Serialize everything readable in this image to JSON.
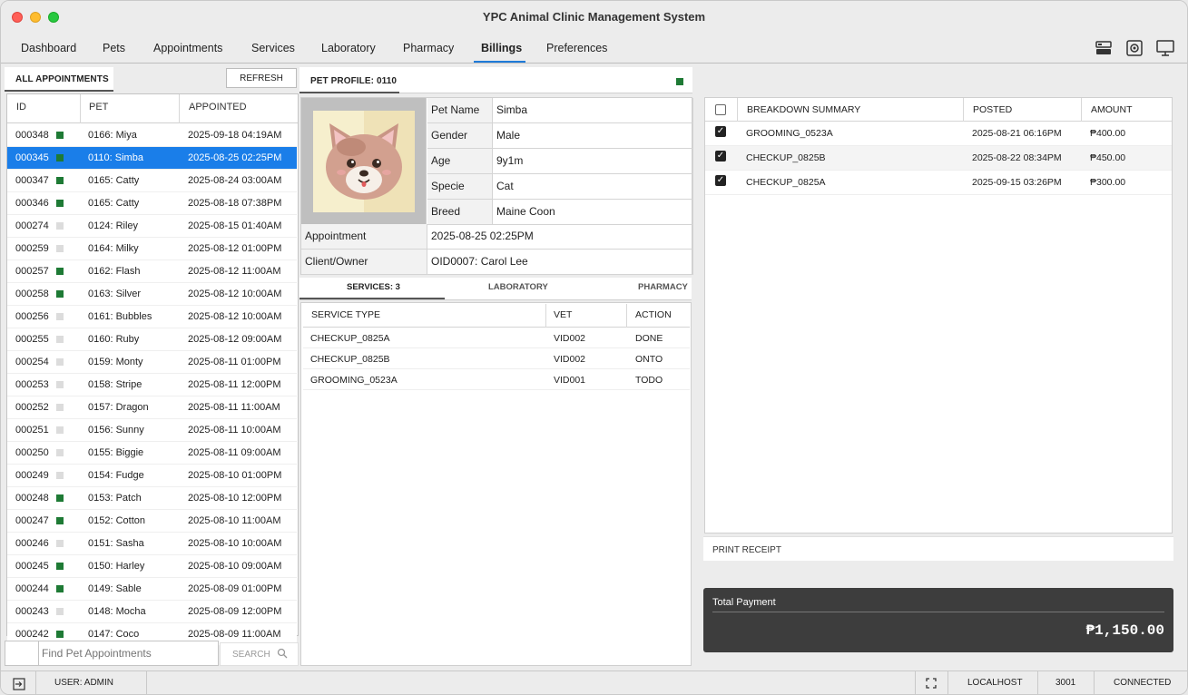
{
  "window": {
    "title": "YPC Animal Clinic Management System"
  },
  "menu": {
    "items": [
      "Dashboard",
      "Pets",
      "Appointments",
      "Services",
      "Laboratory",
      "Pharmacy",
      "Billings",
      "Preferences"
    ],
    "active": "Billings",
    "icons": [
      "database-icon",
      "settings-gear-icon",
      "monitor-icon"
    ]
  },
  "appointments": {
    "tab_label": "ALL APPOINTMENTS",
    "refresh_label": "REFRESH",
    "columns": [
      "ID",
      "PET",
      "APPOINTED"
    ],
    "rows": [
      {
        "id": "000348",
        "pet": "0166: Miya",
        "appointed": "2025-09-18 04:19AM",
        "status": "green"
      },
      {
        "id": "000345",
        "pet": "0110: Simba",
        "appointed": "2025-08-25 02:25PM",
        "status": "green"
      },
      {
        "id": "000347",
        "pet": "0165: Catty",
        "appointed": "2025-08-24 03:00AM",
        "status": "green"
      },
      {
        "id": "000346",
        "pet": "0165: Catty",
        "appointed": "2025-08-18 07:38PM",
        "status": "green"
      },
      {
        "id": "000274",
        "pet": "0124: Riley",
        "appointed": "2025-08-15 01:40AM",
        "status": "gray"
      },
      {
        "id": "000259",
        "pet": "0164: Milky",
        "appointed": "2025-08-12 01:00PM",
        "status": "gray"
      },
      {
        "id": "000257",
        "pet": "0162: Flash",
        "appointed": "2025-08-12 11:00AM",
        "status": "green"
      },
      {
        "id": "000258",
        "pet": "0163: Silver",
        "appointed": "2025-08-12 10:00AM",
        "status": "green"
      },
      {
        "id": "000256",
        "pet": "0161: Bubbles",
        "appointed": "2025-08-12 10:00AM",
        "status": "gray"
      },
      {
        "id": "000255",
        "pet": "0160: Ruby",
        "appointed": "2025-08-12 09:00AM",
        "status": "gray"
      },
      {
        "id": "000254",
        "pet": "0159: Monty",
        "appointed": "2025-08-11 01:00PM",
        "status": "gray"
      },
      {
        "id": "000253",
        "pet": "0158: Stripe",
        "appointed": "2025-08-11 12:00PM",
        "status": "gray"
      },
      {
        "id": "000252",
        "pet": "0157: Dragon",
        "appointed": "2025-08-11 11:00AM",
        "status": "gray"
      },
      {
        "id": "000251",
        "pet": "0156: Sunny",
        "appointed": "2025-08-11 10:00AM",
        "status": "gray"
      },
      {
        "id": "000250",
        "pet": "0155: Biggie",
        "appointed": "2025-08-11 09:00AM",
        "status": "gray"
      },
      {
        "id": "000249",
        "pet": "0154: Fudge",
        "appointed": "2025-08-10 01:00PM",
        "status": "gray"
      },
      {
        "id": "000248",
        "pet": "0153: Patch",
        "appointed": "2025-08-10 12:00PM",
        "status": "green"
      },
      {
        "id": "000247",
        "pet": "0152: Cotton",
        "appointed": "2025-08-10 11:00AM",
        "status": "green"
      },
      {
        "id": "000246",
        "pet": "0151: Sasha",
        "appointed": "2025-08-10 10:00AM",
        "status": "gray"
      },
      {
        "id": "000245",
        "pet": "0150: Harley",
        "appointed": "2025-08-10 09:00AM",
        "status": "green"
      },
      {
        "id": "000244",
        "pet": "0149: Sable",
        "appointed": "2025-08-09 01:00PM",
        "status": "green"
      },
      {
        "id": "000243",
        "pet": "0148: Mocha",
        "appointed": "2025-08-09 12:00PM",
        "status": "gray"
      },
      {
        "id": "000242",
        "pet": "0147: Coco",
        "appointed": "2025-08-09 11:00AM",
        "status": "green"
      }
    ],
    "selected_id": "000345",
    "search_placeholder": "Find Pet Appointments",
    "search_label": "SEARCH"
  },
  "pet_profile": {
    "tab_label": "PET PROFILE: 0110",
    "fields": [
      {
        "label": "Pet Name",
        "value": "Simba"
      },
      {
        "label": "Gender",
        "value": "Male"
      },
      {
        "label": "Age",
        "value": "9y1m"
      },
      {
        "label": "Specie",
        "value": "Cat"
      },
      {
        "label": "Breed",
        "value": "Maine Coon"
      }
    ],
    "appointment_label": "Appointment",
    "appointment_value": "2025-08-25 02:25PM",
    "owner_label": "Client/Owner",
    "owner_value": "OID0007: Carol Lee"
  },
  "detail_tabs": {
    "services": "SERVICES: 3",
    "laboratory": "LABORATORY",
    "pharmacy": "PHARMACY"
  },
  "services": {
    "columns": [
      "SERVICE TYPE",
      "VET",
      "ACTION"
    ],
    "rows": [
      {
        "type": "CHECKUP_0825A",
        "vet": "VID002",
        "action": "DONE"
      },
      {
        "type": "CHECKUP_0825B",
        "vet": "VID002",
        "action": "ONTO"
      },
      {
        "type": "GROOMING_0523A",
        "vet": "VID001",
        "action": "TODO"
      }
    ]
  },
  "breakdown": {
    "columns": [
      "BREAKDOWN SUMMARY",
      "POSTED",
      "AMOUNT"
    ],
    "rows": [
      {
        "checked": true,
        "summary": "GROOMING_0523A",
        "posted": "2025-08-21 06:16PM",
        "amount": "₱400.00"
      },
      {
        "checked": true,
        "summary": "CHECKUP_0825B",
        "posted": "2025-08-22 08:34PM",
        "amount": "₱450.00"
      },
      {
        "checked": true,
        "summary": "CHECKUP_0825A",
        "posted": "2025-09-15 03:26PM",
        "amount": "₱300.00"
      }
    ],
    "print_label": "PRINT RECEIPT",
    "total_label": "Total Payment",
    "total_value": "₱1,150.00"
  },
  "status": {
    "user": "USER: ADMIN",
    "host": "LOCALHOST",
    "port": "3001",
    "connection": "CONNECTED"
  },
  "colors": {
    "accent": "#1a7ee9",
    "status_green": "#1e7a35",
    "status_gray": "#dcdcdc",
    "total_bg": "#3d3d3d"
  }
}
